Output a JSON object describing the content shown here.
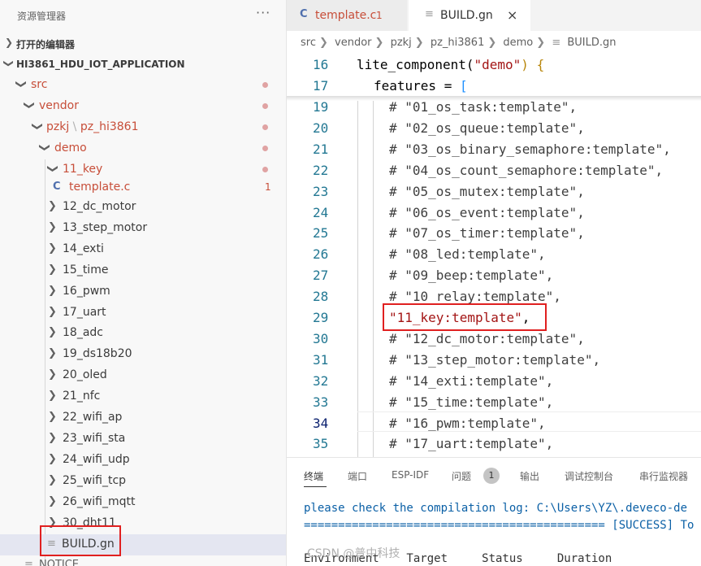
{
  "sidebar": {
    "title": "资源管理器",
    "more": "···",
    "open_editors": "打开的编辑器",
    "project": "HI3861_HDU_IOT_APPLICATION",
    "tree": {
      "src": "src",
      "vendor": "vendor",
      "pzkj": "pzkj",
      "pz_hi3861": "pz_hi3861",
      "demo": "demo",
      "key": "11_key",
      "template_c": "template.c",
      "template_count": "1",
      "folders": [
        "12_dc_motor",
        "13_step_motor",
        "14_exti",
        "15_time",
        "16_pwm",
        "17_uart",
        "18_adc",
        "19_ds18b20",
        "20_oled",
        "21_nfc",
        "22_wifi_ap",
        "23_wifi_sta",
        "24_wifi_udp",
        "25_wifi_tcp",
        "26_wifi_mqtt",
        "30_dht11"
      ],
      "build_gn": "BUILD.gn",
      "notice": "NOTICE"
    }
  },
  "editor": {
    "tabs": [
      {
        "icon": "C",
        "label": "template.c",
        "count": "1"
      },
      {
        "label": "BUILD.gn",
        "close": "×"
      }
    ],
    "breadcrumb": [
      "src",
      "vendor",
      "pzkj",
      "pz_hi3861",
      "demo",
      "BUILD.gn"
    ],
    "sticky": [
      {
        "num": "16",
        "pre": "lite_component(",
        "str": "\"demo\"",
        "post": ") {"
      },
      {
        "num": "17",
        "pre": "features = ",
        "bracket": "["
      }
    ],
    "lines": [
      {
        "num": "19",
        "text": "# \"01_os_task:template\","
      },
      {
        "num": "20",
        "text": "# \"02_os_queue:template\","
      },
      {
        "num": "21",
        "text": "# \"03_os_binary_semaphore:template\","
      },
      {
        "num": "22",
        "text": "# \"04_os_count_semaphore:template\","
      },
      {
        "num": "23",
        "text": "# \"05_os_mutex:template\","
      },
      {
        "num": "24",
        "text": "# \"06_os_event:template\","
      },
      {
        "num": "25",
        "text": "# \"07_os_timer:template\","
      },
      {
        "num": "26",
        "text": "# \"08_led:template\","
      },
      {
        "num": "27",
        "text": "# \"09_beep:template\","
      },
      {
        "num": "28",
        "text": "# \"10_relay:template\","
      },
      {
        "num": "29",
        "str": "\"11_key:template\"",
        "post": ","
      },
      {
        "num": "30",
        "text": "# \"12_dc_motor:template\","
      },
      {
        "num": "31",
        "text": "# \"13_step_motor:template\","
      },
      {
        "num": "32",
        "text": "# \"14_exti:template\","
      },
      {
        "num": "33",
        "text": "# \"15_time:template\","
      },
      {
        "num": "34",
        "text": "# \"16_pwm:template\","
      },
      {
        "num": "35",
        "text": "# \"17_uart:template\","
      }
    ]
  },
  "panel": {
    "tabs": [
      "终端",
      "端口",
      "ESP-IDF",
      "问题",
      "输出",
      "调试控制台",
      "串行监视器"
    ],
    "problems_count": "1",
    "line1": "please check the compilation log: C:\\Users\\YZ\\.deveco-de",
    "line2": "============================================ [SUCCESS] To",
    "line3": "Environment    Target     Status     Duration"
  },
  "watermark": "CSDN @普中科技"
}
